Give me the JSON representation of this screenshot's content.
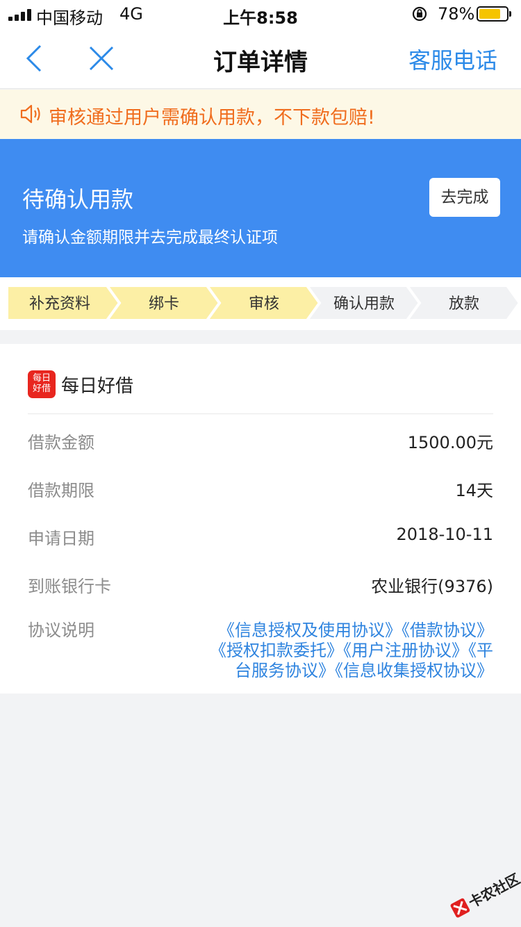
{
  "status_bar": {
    "carrier": "中国移动",
    "network": "4G",
    "time": "上午8:58",
    "battery": "78%",
    "battery_level": 0.78
  },
  "nav": {
    "title": "订单详情",
    "service_label": "客服电话"
  },
  "notice": {
    "text": "审核通过用户需确认用款，不下款包赔!"
  },
  "status_card": {
    "headline": "待确认用款",
    "subtext": "请确认金额期限并去完成最终认证项",
    "button_label": "去完成"
  },
  "steps": [
    {
      "label": "补充资料",
      "done": true
    },
    {
      "label": "绑卡",
      "done": true
    },
    {
      "label": "审核",
      "done": true
    },
    {
      "label": "确认用款",
      "done": false
    },
    {
      "label": "放款",
      "done": false
    }
  ],
  "colors": {
    "accent": "#3f8cf1",
    "link": "#2f84df",
    "notice_text": "#f06d1e",
    "step_done": "#fcefa5",
    "step_todo": "#f1f2f4"
  },
  "loan": {
    "brand_name": "每日好借",
    "brand_logo_text": [
      "每日",
      "好借"
    ],
    "rows": [
      {
        "label": "借款金额",
        "value": "1500.00元"
      },
      {
        "label": "借款期限",
        "value": "14天"
      },
      {
        "label": "申请日期",
        "value": "2018-10-11"
      },
      {
        "label": "到账银行卡",
        "value": "农业银行(9376)"
      }
    ],
    "agreements_label": "协议说明",
    "agreements_lines": [
      "《信息授权及使用协议》《借款协议》",
      "《授权扣款委托》《用户注册协议》《平",
      "台服务协议》《信息收集授权协议》"
    ]
  },
  "watermark": {
    "text": "卡农社区"
  }
}
